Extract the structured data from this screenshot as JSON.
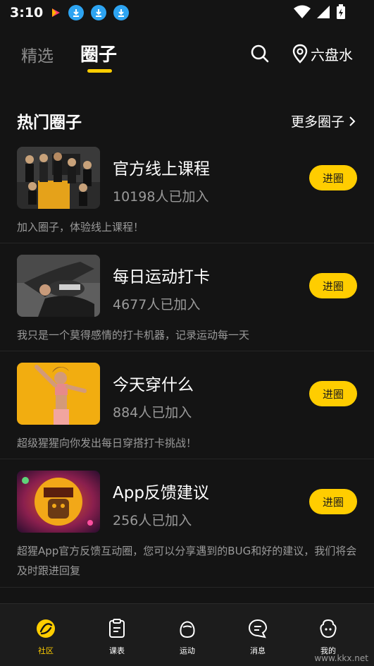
{
  "status_bar": {
    "time": "3:10"
  },
  "top_nav": {
    "tabs": [
      {
        "label": "精选",
        "active": false
      },
      {
        "label": "圈子",
        "active": true
      }
    ],
    "location": "六盘水"
  },
  "section": {
    "title": "热门圈子",
    "more_label": "更多圈子"
  },
  "circles": [
    {
      "name": "官方线上课程",
      "members": "10198人已加入",
      "join_label": "进圈",
      "desc": "加入圈子，体验线上课程！"
    },
    {
      "name": "每日运动打卡",
      "members": "4677人已加入",
      "join_label": "进圈",
      "desc": "我只是一个莫得感情的打卡机器，记录运动每一天"
    },
    {
      "name": "今天穿什么",
      "members": "884人已加入",
      "join_label": "进圈",
      "desc": "超级猩猩向你发出每日穿搭打卡挑战！"
    },
    {
      "name": "App反馈建议",
      "members": "256人已加入",
      "join_label": "进圈",
      "desc": "超猩App官方反馈互动圈，您可以分享遇到的BUG和好的建议，我们将会及时跟进回复"
    }
  ],
  "tab_bar": {
    "items": [
      {
        "label": "社区",
        "icon": "community-icon",
        "active": true
      },
      {
        "label": "课表",
        "icon": "schedule-icon",
        "active": false
      },
      {
        "label": "运动",
        "icon": "sport-icon",
        "active": false
      },
      {
        "label": "消息",
        "icon": "message-icon",
        "active": false
      },
      {
        "label": "我的",
        "icon": "profile-icon",
        "active": false
      }
    ]
  },
  "watermark": "www.kkx.net",
  "colors": {
    "background": "#141414",
    "accent": "#ffcd00",
    "secondary_text": "#9a9a9a"
  }
}
